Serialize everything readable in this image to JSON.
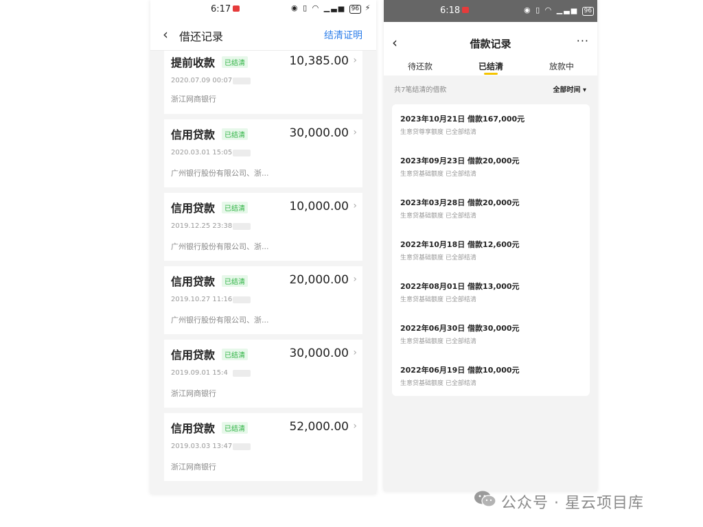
{
  "left": {
    "status": {
      "time": "6:17",
      "battery": "96"
    },
    "nav": {
      "back_icon": "chevron-left-icon",
      "title": "借还记录",
      "action": "结清证明"
    },
    "loans": [
      {
        "name": "提前收款",
        "tag": "已结清",
        "amount": "10,385.00",
        "date": "2020.07.09 00:07",
        "bank": "浙江网商银行"
      },
      {
        "name": "信用贷款",
        "tag": "已结清",
        "amount": "30,000.00",
        "date": "2020.03.01 15:05",
        "bank": "广州银行股份有限公司、浙..."
      },
      {
        "name": "信用贷款",
        "tag": "已结清",
        "amount": "10,000.00",
        "date": "2019.12.25 23:38",
        "bank": "广州银行股份有限公司、浙..."
      },
      {
        "name": "信用贷款",
        "tag": "已结清",
        "amount": "20,000.00",
        "date": "2019.10.27 11:16",
        "bank": "广州银行股份有限公司、浙..."
      },
      {
        "name": "信用贷款",
        "tag": "已结清",
        "amount": "30,000.00",
        "date": "2019.09.01 15:4",
        "bank": "浙江网商银行"
      },
      {
        "name": "信用贷款",
        "tag": "已结清",
        "amount": "52,000.00",
        "date": "2019.03.03 13:47",
        "bank": "浙江网商银行"
      }
    ]
  },
  "right": {
    "status": {
      "time": "6:18",
      "battery": "96"
    },
    "header": {
      "title": "借款记录",
      "more": "···"
    },
    "tabs": [
      {
        "label": "待还款"
      },
      {
        "label": "已结清"
      },
      {
        "label": "放款中"
      }
    ],
    "summary": "共7笔结清的借款",
    "filter": "全部时间 ▾",
    "records": [
      {
        "title": "2023年10月21日 借款167,000元",
        "sub": "生意贷尊享额度 已全部结清"
      },
      {
        "title": "2023年09月23日 借款20,000元",
        "sub": "生意贷基础额度 已全部结清"
      },
      {
        "title": "2023年03月28日 借款20,000元",
        "sub": "生意贷基础额度 已全部结清"
      },
      {
        "title": "2022年10月18日 借款12,600元",
        "sub": "生意贷基础额度 已全部结清"
      },
      {
        "title": "2022年08月01日 借款13,000元",
        "sub": "生意贷基础额度 已全部结清"
      },
      {
        "title": "2022年06月30日 借款30,000元",
        "sub": "生意贷基础额度 已全部结清"
      },
      {
        "title": "2022年06月19日 借款10,000元",
        "sub": "生意贷基础额度 已全部结清"
      }
    ]
  },
  "watermark": {
    "text": "公众号 · 星云项目库",
    "icon": "wechat-icon"
  },
  "colors": {
    "accent_blue": "#2b7de9",
    "settled_green": "#2fb344",
    "tab_yellow": "#f5c400"
  }
}
